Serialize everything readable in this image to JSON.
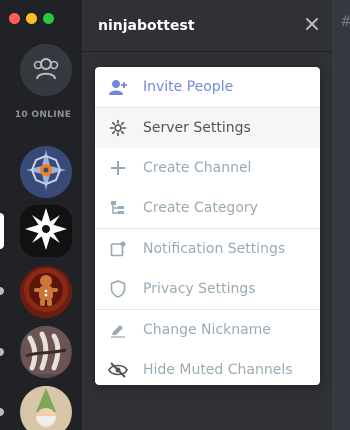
{
  "window": {
    "controls": [
      "close",
      "minimize",
      "maximize"
    ]
  },
  "rail": {
    "online_label": "10 ONLINE",
    "servers": [
      {
        "name": "server-1",
        "icon": "shuriken-orange-icon"
      },
      {
        "name": "server-2",
        "icon": "shuriken-white-icon",
        "selected": true
      },
      {
        "name": "server-3",
        "icon": "gingerbread-icon"
      },
      {
        "name": "server-4",
        "icon": "claws-icon"
      },
      {
        "name": "server-5",
        "icon": "gnome-icon"
      }
    ]
  },
  "header": {
    "server_name": "ninjabottest"
  },
  "menu": {
    "items": [
      {
        "label": "Invite People",
        "icon": "add-user-icon"
      },
      {
        "label": "Server Settings",
        "icon": "gear-icon"
      },
      {
        "label": "Create Channel",
        "icon": "plus-icon"
      },
      {
        "label": "Create Category",
        "icon": "category-icon"
      },
      {
        "label": "Notification Settings",
        "icon": "notification-icon"
      },
      {
        "label": "Privacy Settings",
        "icon": "shield-icon"
      },
      {
        "label": "Change Nickname",
        "icon": "pencil-icon"
      },
      {
        "label": "Hide Muted Channels",
        "icon": "eye-off-icon"
      }
    ]
  },
  "colors": {
    "accent": "#7289da",
    "rail_bg": "#202225",
    "sidebar_bg": "#2f3136"
  }
}
